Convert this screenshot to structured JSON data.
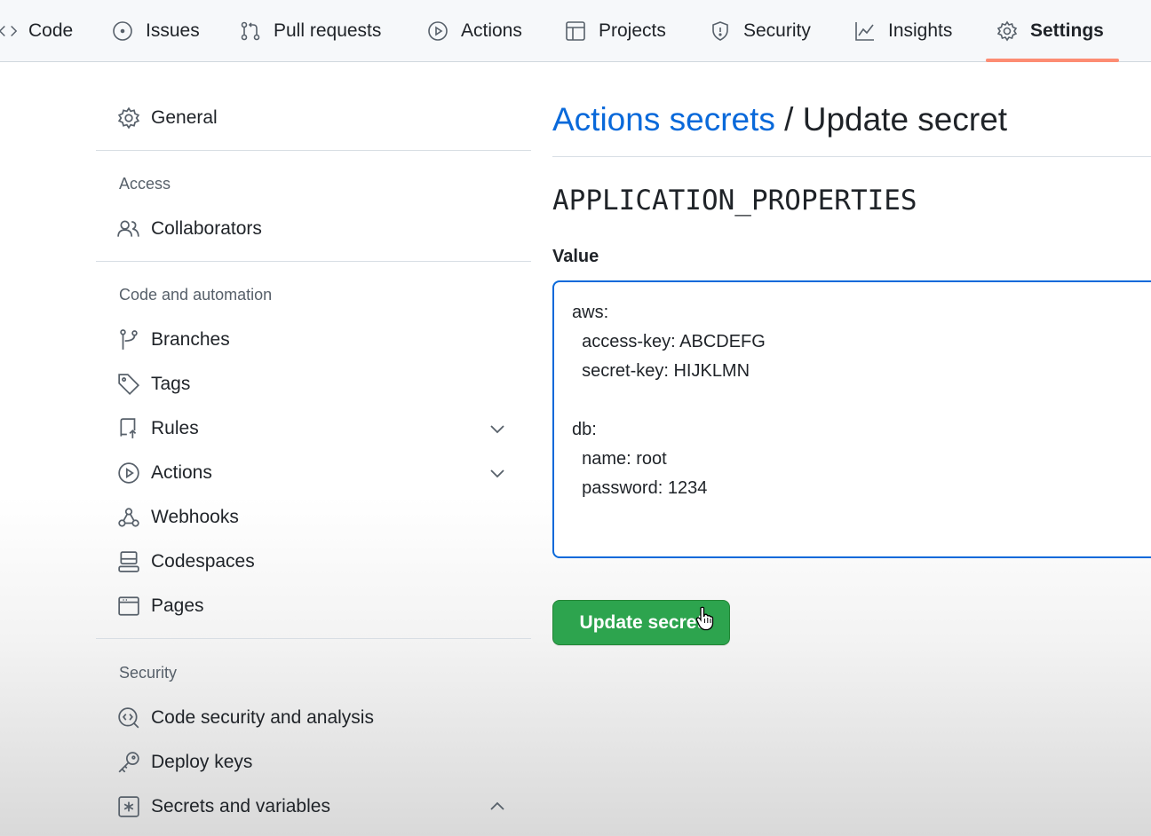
{
  "nav": {
    "tabs": [
      {
        "label": "Code",
        "icon": "code-icon"
      },
      {
        "label": "Issues",
        "icon": "issue-circle-icon"
      },
      {
        "label": "Pull requests",
        "icon": "pull-request-icon"
      },
      {
        "label": "Actions",
        "icon": "play-circle-icon"
      },
      {
        "label": "Projects",
        "icon": "table-icon"
      },
      {
        "label": "Security",
        "icon": "shield-icon"
      },
      {
        "label": "Insights",
        "icon": "graph-icon"
      },
      {
        "label": "Settings",
        "icon": "gear-icon",
        "selected": true
      }
    ],
    "selected_underline_color": "#fd8c73"
  },
  "sidebar": {
    "general": "General",
    "sections": [
      {
        "heading": "Access",
        "items": [
          {
            "label": "Collaborators",
            "icon": "people-icon"
          }
        ]
      },
      {
        "heading": "Code and automation",
        "items": [
          {
            "label": "Branches",
            "icon": "git-branch-icon"
          },
          {
            "label": "Tags",
            "icon": "tag-icon"
          },
          {
            "label": "Rules",
            "icon": "repo-push-icon",
            "expandable": true
          },
          {
            "label": "Actions",
            "icon": "play-circle-icon",
            "expandable": true
          },
          {
            "label": "Webhooks",
            "icon": "webhook-icon"
          },
          {
            "label": "Codespaces",
            "icon": "codespaces-icon"
          },
          {
            "label": "Pages",
            "icon": "browser-icon"
          }
        ]
      },
      {
        "heading": "Security",
        "items": [
          {
            "label": "Code security and analysis",
            "icon": "codescan-icon"
          },
          {
            "label": "Deploy keys",
            "icon": "key-icon"
          },
          {
            "label": "Secrets and variables",
            "icon": "asterisk-box-icon",
            "expanded": true
          }
        ]
      }
    ]
  },
  "main": {
    "breadcrumb_link": "Actions secrets",
    "breadcrumb_sep": " / ",
    "breadcrumb_current": "Update secret",
    "secret_name": "APPLICATION_PROPERTIES",
    "value_label": "Value",
    "value": "aws:\n  access-key: ABCDEFG\n  secret-key: HIJKLMN\n\ndb:\n  name: root\n  password: 1234",
    "submit_label": "Update secret"
  },
  "colors": {
    "link": "#0969da",
    "button_green": "#2da44e",
    "focus_border": "#0969da"
  }
}
